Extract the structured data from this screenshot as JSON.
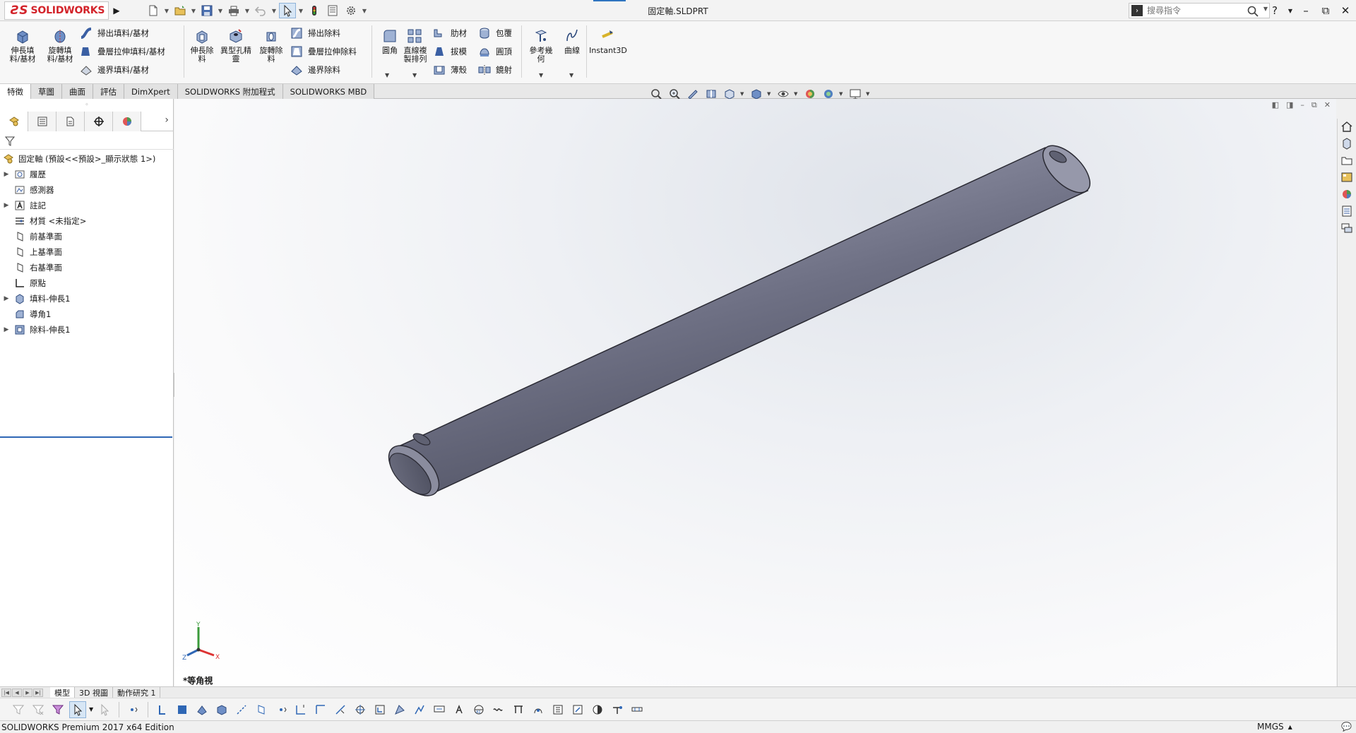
{
  "titlebar": {
    "app_logo_text": "SOLIDWORKS",
    "doc_title": "固定軸.SLDPRT",
    "search_placeholder": "搜尋指令",
    "help": "?",
    "minimize": "–",
    "restore": "⧉",
    "close": "✕"
  },
  "ribbon": {
    "extrude_boss": "伸長填料/基材",
    "revolve_boss": "旋轉填料/基材",
    "swept_boss": "掃出填料/基材",
    "loft_boss": "疊層拉伸填料/基材",
    "boundary_boss": "邊界填料/基材",
    "extrude_cut": "伸長除料",
    "hole_wizard": "異型孔精靈",
    "revolve_cut": "旋轉除料",
    "swept_cut": "掃出除料",
    "loft_cut": "疊層拉伸除料",
    "boundary_cut": "邊界除料",
    "fillet": "圓角",
    "linear_pattern": "直線複製排列",
    "rib": "肋材",
    "wrap": "包覆",
    "draft": "拔模",
    "dome": "圓頂",
    "shell": "薄殼",
    "mirror": "鏡射",
    "reference_geometry": "參考幾何",
    "curves": "曲線",
    "instant3d": "Instant3D"
  },
  "command_tabs": [
    "特徵",
    "草圖",
    "曲面",
    "評估",
    "DimXpert",
    "SOLIDWORKS 附加程式",
    "SOLIDWORKS MBD"
  ],
  "feature_tree": {
    "root": "固定軸 (預設<<預設>_顯示狀態 1>)",
    "items": [
      {
        "label": "履歷",
        "expandable": true,
        "icon": "history-icon"
      },
      {
        "label": "感測器",
        "expandable": false,
        "icon": "sensor-icon"
      },
      {
        "label": "註記",
        "expandable": true,
        "icon": "annotation-icon"
      },
      {
        "label": "材質 <未指定>",
        "expandable": false,
        "icon": "material-icon"
      },
      {
        "label": "前基準面",
        "expandable": false,
        "icon": "plane-icon"
      },
      {
        "label": "上基準面",
        "expandable": false,
        "icon": "plane-icon"
      },
      {
        "label": "右基準面",
        "expandable": false,
        "icon": "plane-icon"
      },
      {
        "label": "原點",
        "expandable": false,
        "icon": "origin-icon"
      },
      {
        "label": "填料-伸長1",
        "expandable": true,
        "icon": "extrude-icon"
      },
      {
        "label": "導角1",
        "expandable": false,
        "icon": "chamfer-icon"
      },
      {
        "label": "除料-伸長1",
        "expandable": true,
        "icon": "cut-extrude-icon"
      }
    ]
  },
  "graphics": {
    "view_name": "*等角視",
    "triad_x": "X",
    "triad_y": "Y",
    "triad_z": "Z"
  },
  "bottom_tabs": [
    "模型",
    "3D 視圖",
    "動作研究 1"
  ],
  "statusbar": {
    "edition": "SOLIDWORKS Premium 2017 x64 Edition",
    "units": "MMGS"
  },
  "colors": {
    "brand_red": "#d3242b",
    "part_gray": "#7c7e92",
    "selection_blue": "#2f67b5"
  }
}
